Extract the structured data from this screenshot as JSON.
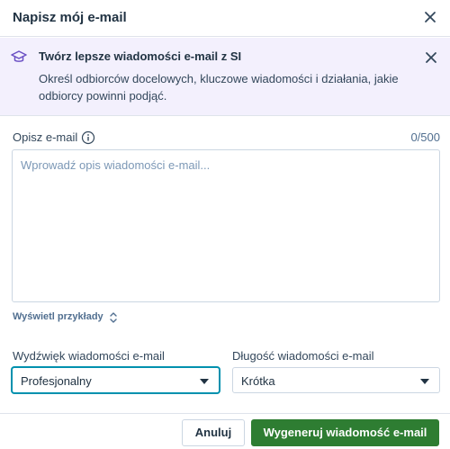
{
  "dialog": {
    "title": "Napisz mój e-mail",
    "close_icon": "close-icon"
  },
  "banner": {
    "icon": "graduation-cap-icon",
    "title": "Twórz lepsze wiadomości e-mail z SI",
    "text": "Określ odbiorców docelowych, kluczowe wiadomości i działania, jakie odbiorcy powinni podjąć.",
    "close_icon": "close-icon"
  },
  "description": {
    "label": "Opisz e-mail",
    "info_icon": "info-icon",
    "counter": "0/500",
    "placeholder": "Wprowadź opis wiadomości e-mail...",
    "value": ""
  },
  "examples": {
    "label": "Wyświetl przykłady",
    "icon": "chevron-up-down-icon"
  },
  "tone": {
    "label": "Wydźwięk wiadomości e-mail",
    "value": "Profesjonalny"
  },
  "length": {
    "label": "Długość wiadomości e-mail",
    "value": "Krótka"
  },
  "footer": {
    "cancel_label": "Anuluj",
    "generate_label": "Wygeneruj wiadomość e-mail"
  },
  "colors": {
    "banner_bg": "#f3f0fd",
    "primary_button": "#2e7d32",
    "focus_border": "#0091ae"
  }
}
